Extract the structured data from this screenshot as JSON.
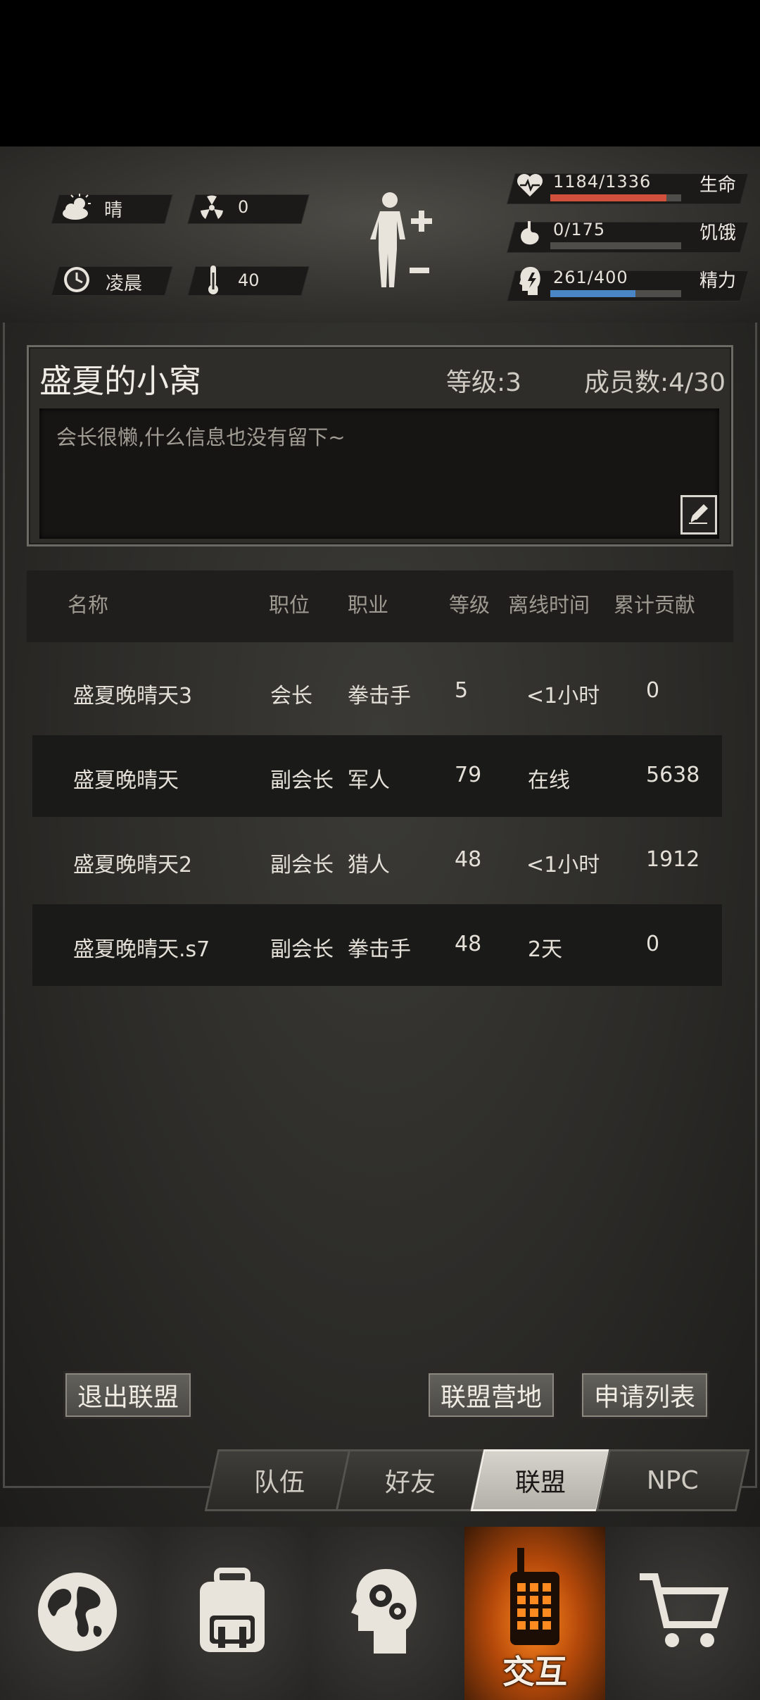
{
  "status": {
    "weather_label": "晴",
    "radiation_value": "0",
    "time_label": "凌晨",
    "temperature_value": "40"
  },
  "stats": [
    {
      "value": "1184/1336",
      "label": "生命",
      "ratio": 0.886,
      "color": "#d0503c"
    },
    {
      "value": "0/175",
      "label": "饥饿",
      "ratio": 0.0,
      "color": "#7a7772"
    },
    {
      "value": "261/400",
      "label": "精力",
      "ratio": 0.6525,
      "color": "#4a86c5"
    }
  ],
  "guild": {
    "name": "盛夏的小窝",
    "level": "等级:3",
    "members": "成员数:4/30",
    "description": "会长很懒,什么信息也没有留下~"
  },
  "table": {
    "headers": [
      "名称",
      "职位",
      "职业",
      "等级",
      "离线时间",
      "累计贡献"
    ],
    "rows": [
      [
        "盛夏晚晴天3",
        "会长",
        "拳击手",
        "5",
        "<1小时",
        "0"
      ],
      [
        "盛夏晚晴天",
        "副会长",
        "军人",
        "79",
        "在线",
        "5638"
      ],
      [
        "盛夏晚晴天2",
        "副会长",
        "猎人",
        "48",
        "<1小时",
        "1912"
      ],
      [
        "盛夏晚晴天.s7",
        "副会长",
        "拳击手",
        "48",
        "2天",
        "0"
      ]
    ]
  },
  "actions": {
    "leave": "退出联盟",
    "camp": "联盟营地",
    "applications": "申请列表"
  },
  "tabs": [
    "队伍",
    "好友",
    "联盟",
    "NPC"
  ],
  "active_tab": "联盟",
  "bottom_nav": {
    "interact_label": "交互"
  },
  "icons": [
    "cloud-sun-icon",
    "radiation-icon",
    "clock-icon",
    "thermometer-icon",
    "body-status-icon",
    "heart-icon",
    "stomach-icon",
    "energy-head-icon",
    "edit-icon",
    "globe-icon",
    "backpack-icon",
    "skills-head-icon",
    "walkie-talkie-icon",
    "cart-icon"
  ]
}
